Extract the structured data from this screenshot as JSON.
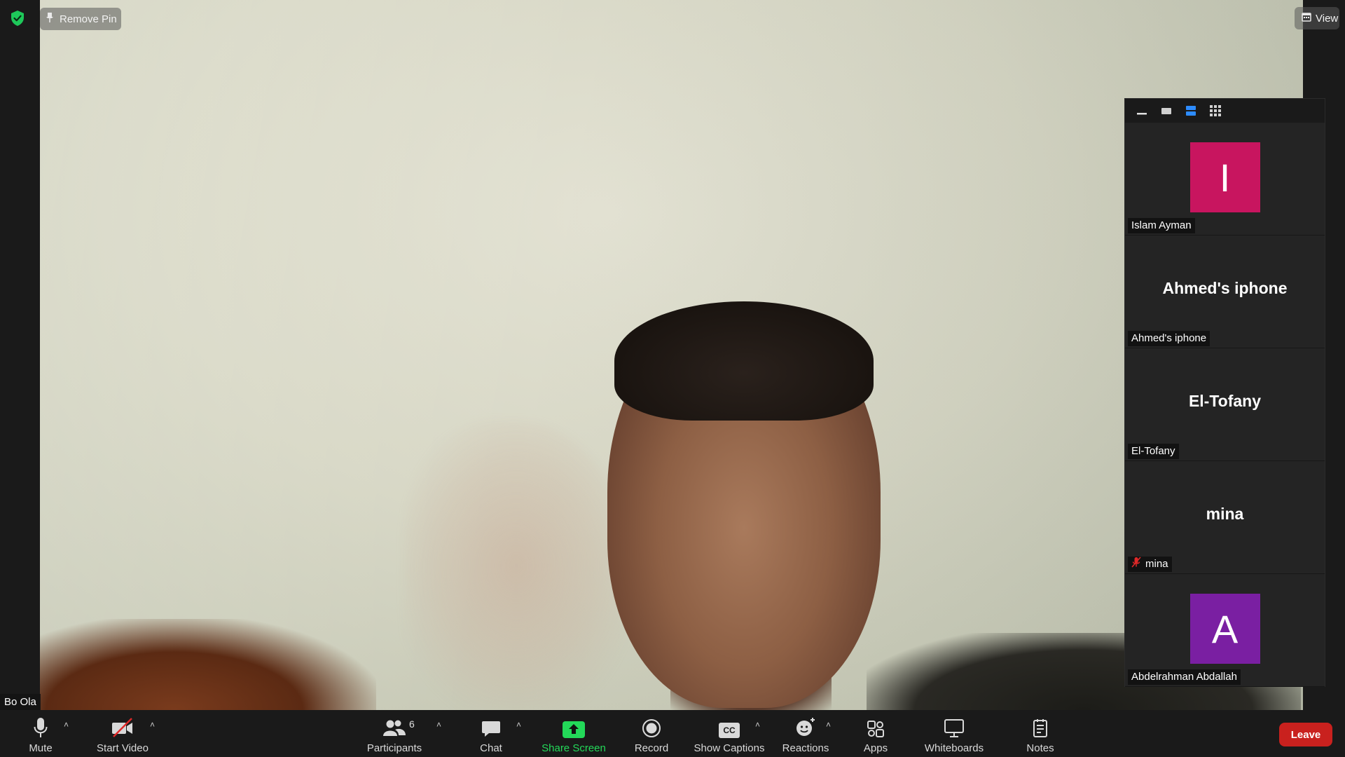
{
  "main_video": {
    "pin_label": "Remove Pin",
    "view_label": "View",
    "participant_name": "Bo Ola"
  },
  "side_panel": {
    "tiles": [
      {
        "name": "Islam Ayman",
        "avatar_letter": "I",
        "avatar_color": "#c8155f",
        "display": "avatar"
      },
      {
        "name": "Ahmed's iphone",
        "display_name": "Ahmed's iphone",
        "display": "name"
      },
      {
        "name": "El-Tofany",
        "display_name": "El-Tofany",
        "display": "name"
      },
      {
        "name": "mina",
        "display_name": "mina",
        "display": "name",
        "muted": true
      },
      {
        "name": "Abdelrahman Abdallah",
        "avatar_letter": "A",
        "avatar_color": "#7a1fa2",
        "display": "avatar"
      }
    ]
  },
  "toolbar": {
    "mute": "Mute",
    "start_video": "Start Video",
    "participants": "Participants",
    "participants_count": "6",
    "chat": "Chat",
    "share_screen": "Share Screen",
    "record": "Record",
    "show_captions": "Show Captions",
    "captions_icon_text": "CC",
    "reactions": "Reactions",
    "apps": "Apps",
    "whiteboards": "Whiteboards",
    "notes": "Notes",
    "leave": "Leave"
  },
  "colors": {
    "share_green": "#23d959",
    "leave_red": "#c9211e",
    "shield_green": "#1ec85a",
    "active_view_blue": "#2d8cff"
  }
}
